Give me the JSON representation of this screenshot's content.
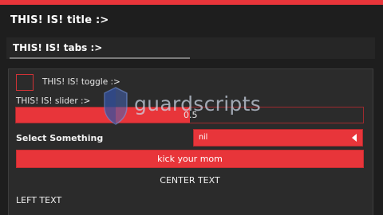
{
  "window": {
    "title": "THIS! IS! title :>",
    "accent_color": "#e8353a"
  },
  "tabs": [
    {
      "label": "THIS! IS! tabs :>",
      "selected": true
    }
  ],
  "controls": {
    "toggle": {
      "label": "THIS! IS! toggle :>",
      "checked": false
    },
    "slider": {
      "label": "THIS! IS! slider :>",
      "value": "0.5",
      "fraction": 0.5
    },
    "dropdown": {
      "label": "Select Something",
      "value": "nil",
      "icon": "caret-left-icon"
    },
    "button": {
      "label": "kick your mom"
    },
    "center_text": "CENTER TEXT",
    "left_text": "LEFT TEXT"
  },
  "watermark": {
    "text": "guardscripts",
    "icon": "shield-logo-icon"
  }
}
